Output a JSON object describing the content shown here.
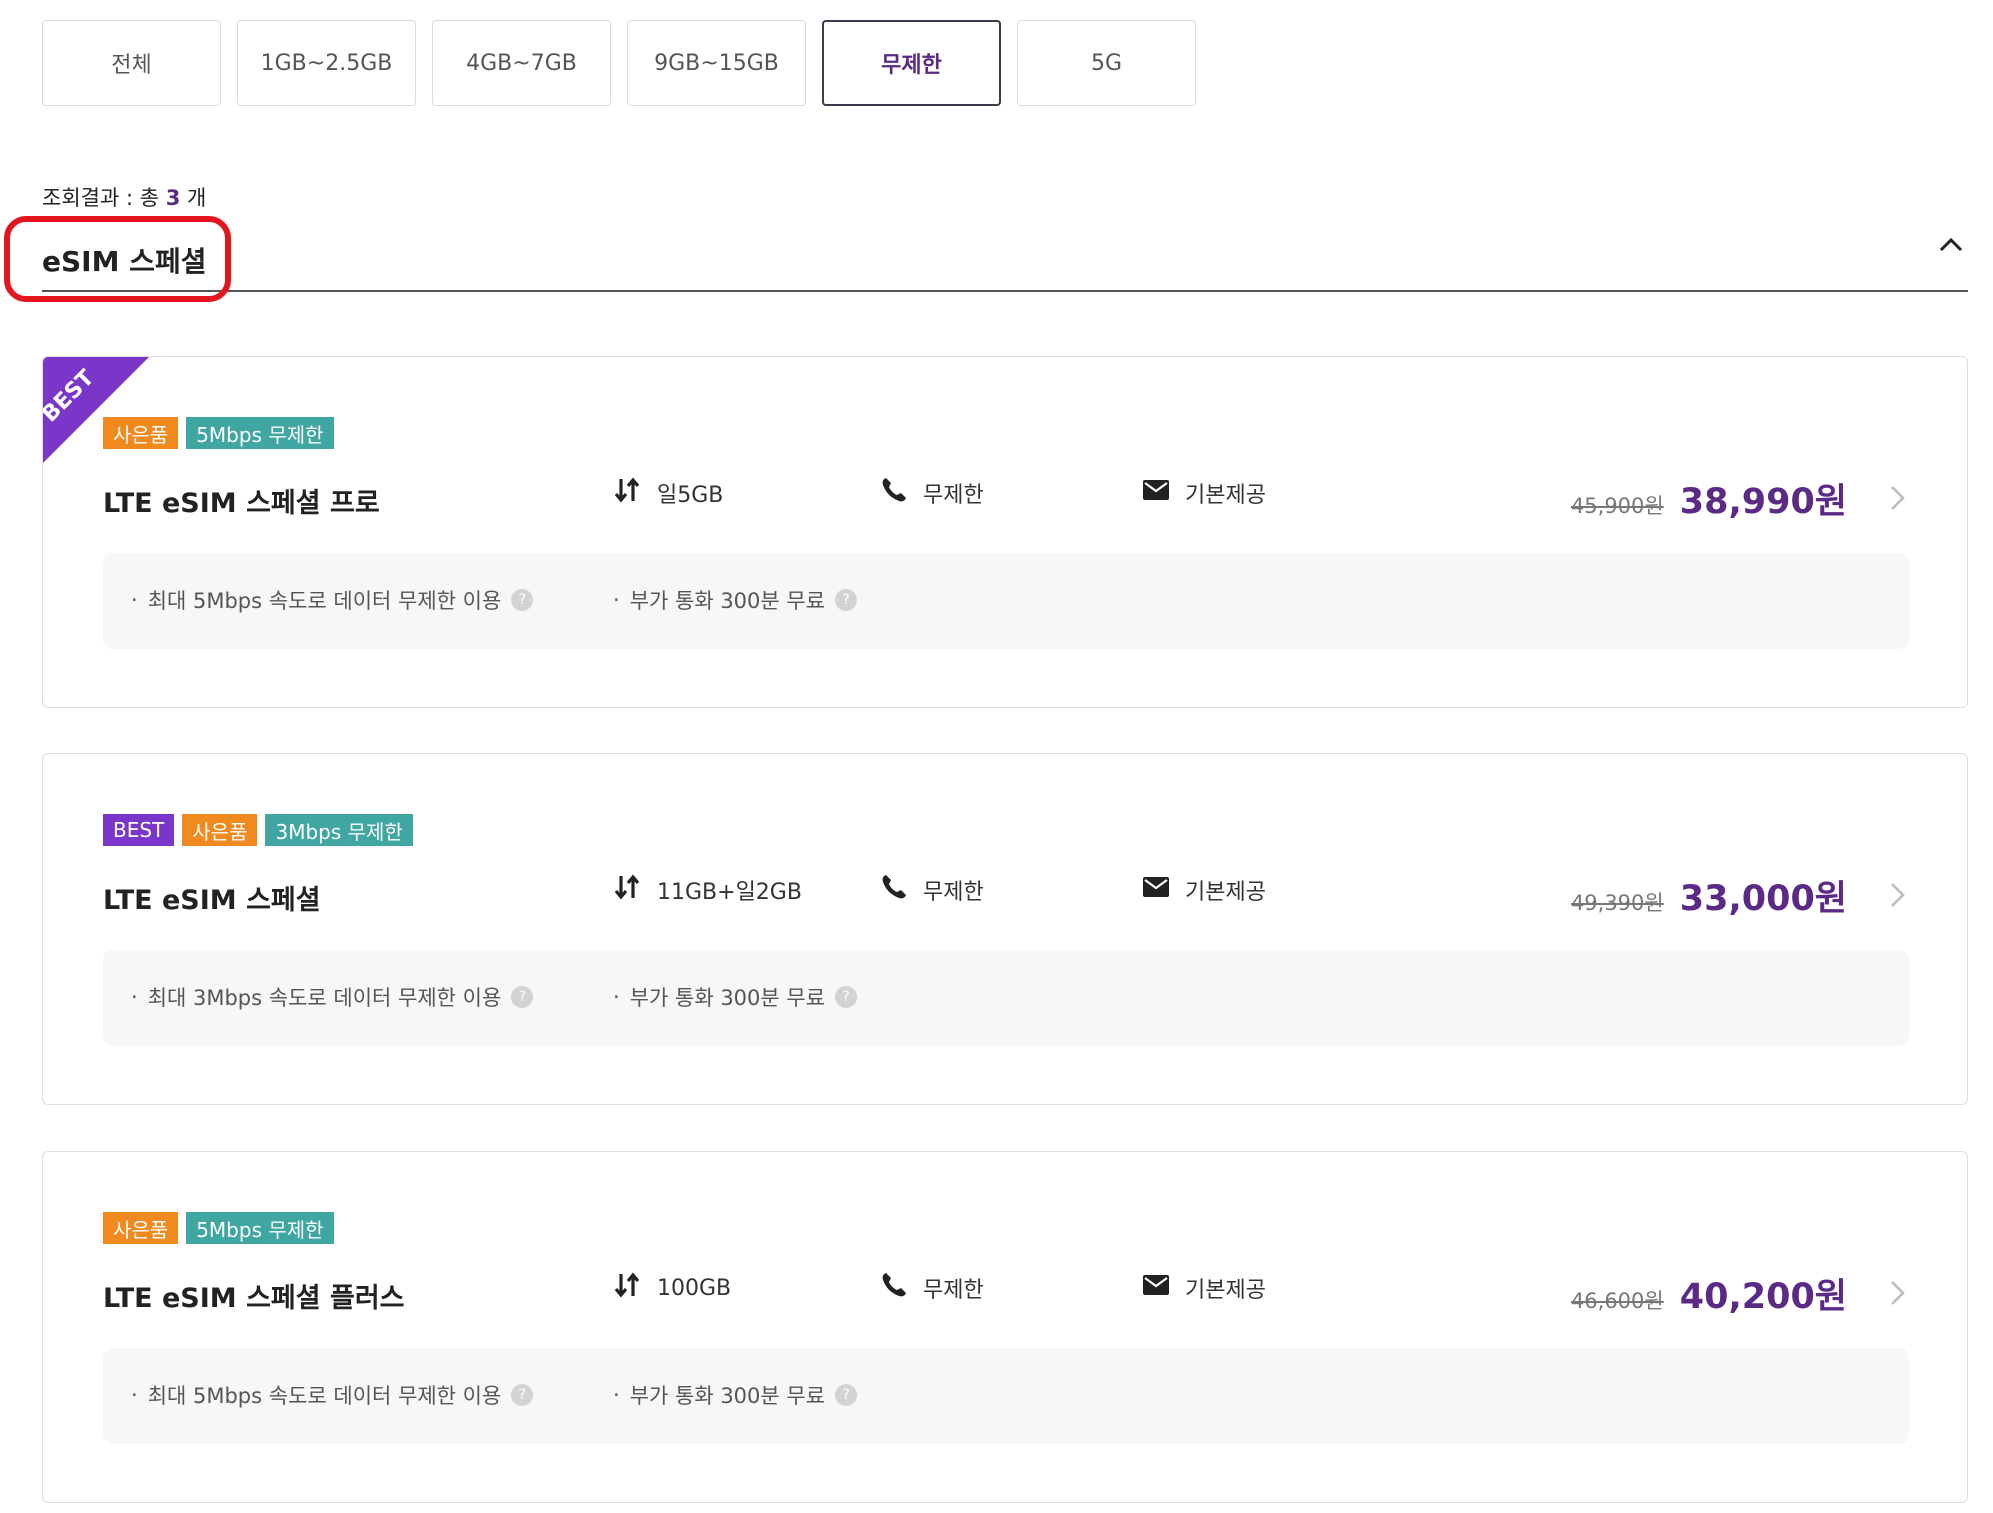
{
  "filters": [
    "전체",
    "1GB~2.5GB",
    "4GB~7GB",
    "9GB~15GB",
    "무제한",
    "5G"
  ],
  "active_filter": "무제한",
  "result": {
    "prefix": "조회결과 : 총 ",
    "count": "3",
    "suffix": " 개"
  },
  "section": {
    "title": "eSIM 스페셜"
  },
  "colors": {
    "accent": "#5b2a86",
    "highlight": "#e3161f",
    "best": "#7a35c9",
    "gift": "#f18a1e",
    "speed": "#3fa6a2"
  },
  "plans": [
    {
      "ribbon": "BEST",
      "badges": [
        {
          "text": "사은품",
          "color": "orange"
        },
        {
          "text": "5Mbps 무제한",
          "color": "teal"
        }
      ],
      "name": "LTE eSIM 스페셜 프로",
      "data": "일5GB",
      "call": "무제한",
      "sms": "기본제공",
      "original_price": "45,900원",
      "price": "38,990원",
      "benefits": [
        "최대 5Mbps 속도로 데이터 무제한 이용",
        "부가 통화 300분 무료"
      ]
    },
    {
      "ribbon": "",
      "badges": [
        {
          "text": "BEST",
          "color": "purple"
        },
        {
          "text": "사은품",
          "color": "orange"
        },
        {
          "text": "3Mbps 무제한",
          "color": "teal"
        }
      ],
      "name": "LTE eSIM 스페셜",
      "data": "11GB+일2GB",
      "call": "무제한",
      "sms": "기본제공",
      "original_price": "49,390원",
      "price": "33,000원",
      "benefits": [
        "최대 3Mbps 속도로 데이터 무제한 이용",
        "부가 통화 300분 무료"
      ]
    },
    {
      "ribbon": "",
      "badges": [
        {
          "text": "사은품",
          "color": "orange"
        },
        {
          "text": "5Mbps 무제한",
          "color": "teal"
        }
      ],
      "name": "LTE eSIM 스페셜 플러스",
      "data": "100GB",
      "call": "무제한",
      "sms": "기본제공",
      "original_price": "46,600원",
      "price": "40,200원",
      "benefits": [
        "최대 5Mbps 속도로 데이터 무제한 이용",
        "부가 통화 300분 무료"
      ]
    }
  ],
  "icons": {
    "data": "data-arrows-icon",
    "call": "phone-icon",
    "sms": "envelope-icon",
    "more": "chevron-right-icon",
    "help": "question-icon",
    "collapse": "chevron-up-icon"
  },
  "help_glyph": "?",
  "bullet": "·"
}
